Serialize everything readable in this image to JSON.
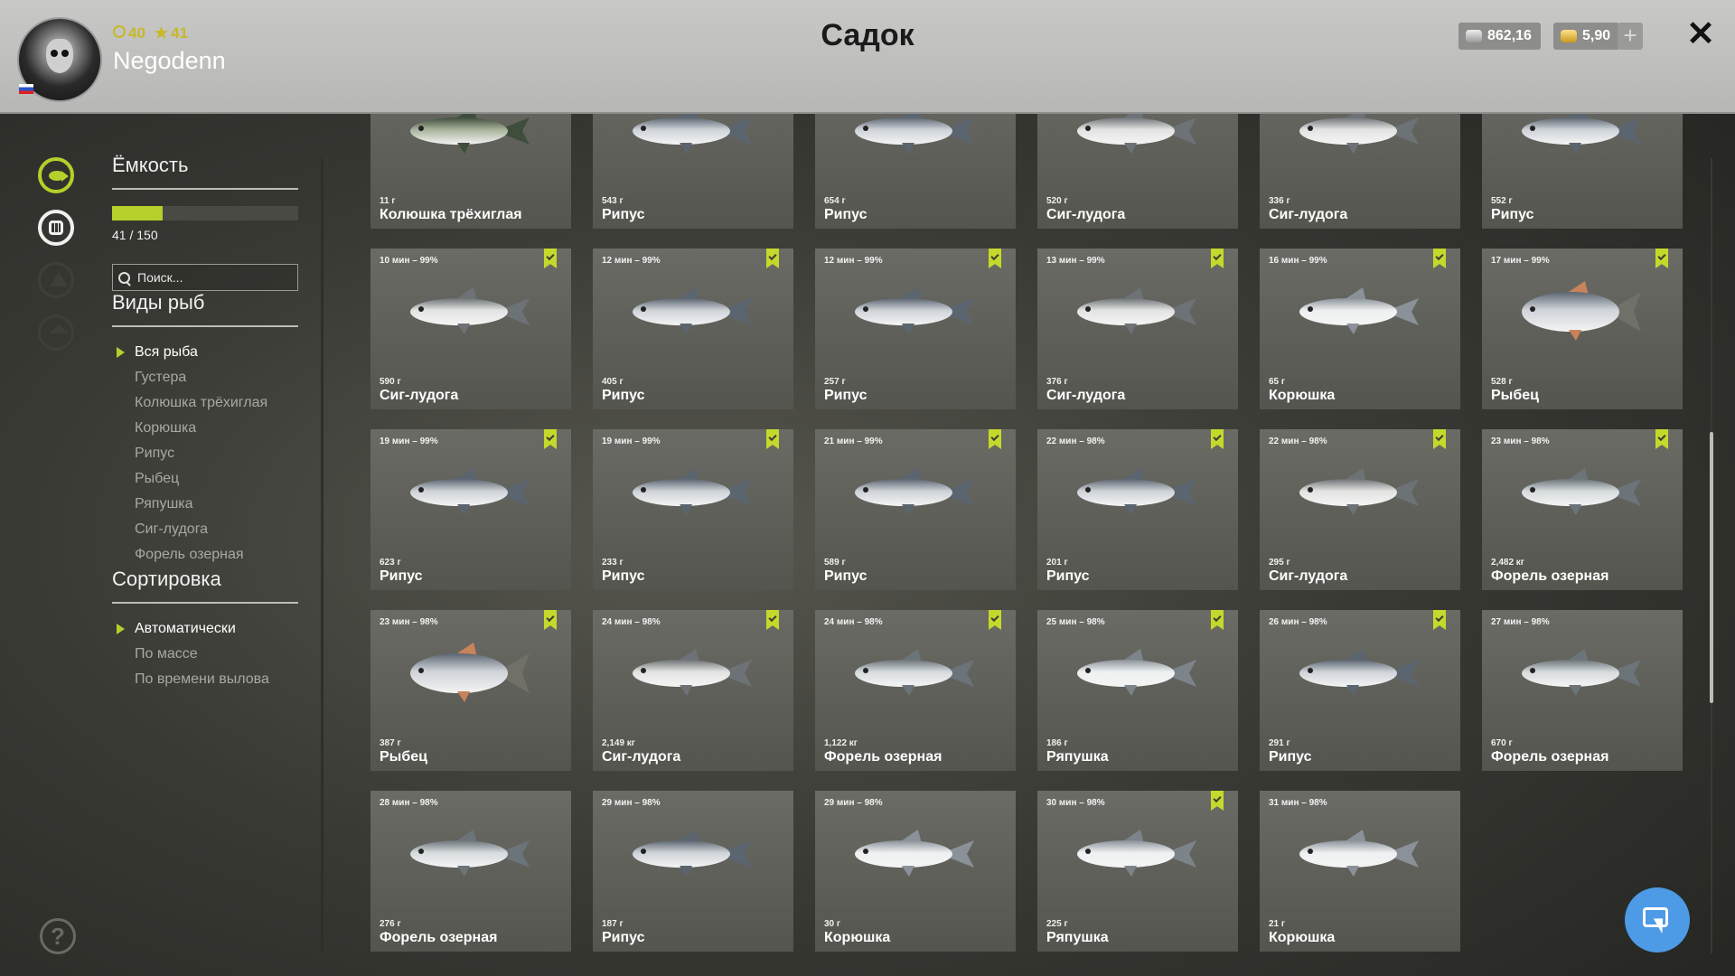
{
  "header": {
    "title": "Садок",
    "player": {
      "name": "Negodenn",
      "level": "40",
      "rank": "41"
    },
    "currency": {
      "silver": "862,16",
      "gold": "5,90"
    },
    "plus_label": "+",
    "close_label": "✕"
  },
  "sidebar": {
    "icons": [
      "fish-icon",
      "keepnet-icon",
      "boat-icon",
      "home-icon"
    ],
    "help_label": "?"
  },
  "capacity": {
    "title": "Ёмкость",
    "current": 41,
    "max": 150,
    "fill_fraction": 0.273,
    "text": "41 / 150"
  },
  "search": {
    "placeholder": "Поиск..."
  },
  "species_filter": {
    "title": "Виды рыб",
    "items": [
      "Вся рыба",
      "Густера",
      "Колюшка трёхиглая",
      "Корюшка",
      "Рипус",
      "Рыбец",
      "Ряпушка",
      "Сиг-лудога",
      "Форель озерная"
    ],
    "active_index": 0
  },
  "sort": {
    "title": "Сортировка",
    "items": [
      "Автоматически",
      "По массе",
      "По времени вылова"
    ],
    "active_index": 0
  },
  "colors": {
    "accent": "#b6cf2a",
    "button_blue": "#4d9be6",
    "card_bg": "#5f5f5a"
  },
  "scroll": {
    "position_fraction": 0.34
  },
  "fish": [
    {
      "time": "",
      "weight": "11 г",
      "species": "Колюшка трёхиглая",
      "bookmarked": false
    },
    {
      "time": "",
      "weight": "543 г",
      "species": "Рипус",
      "bookmarked": false
    },
    {
      "time": "",
      "weight": "654 г",
      "species": "Рипус",
      "bookmarked": false
    },
    {
      "time": "",
      "weight": "520 г",
      "species": "Сиг-лудога",
      "bookmarked": false
    },
    {
      "time": "",
      "weight": "336 г",
      "species": "Сиг-лудога",
      "bookmarked": false
    },
    {
      "time": "",
      "weight": "552 г",
      "species": "Рипус",
      "bookmarked": false
    },
    {
      "time": "10 мин – 99%",
      "weight": "590 г",
      "species": "Сиг-лудога",
      "bookmarked": true
    },
    {
      "time": "12 мин – 99%",
      "weight": "405 г",
      "species": "Рипус",
      "bookmarked": true
    },
    {
      "time": "12 мин – 99%",
      "weight": "257 г",
      "species": "Рипус",
      "bookmarked": true
    },
    {
      "time": "13 мин – 99%",
      "weight": "376 г",
      "species": "Сиг-лудога",
      "bookmarked": true
    },
    {
      "time": "16 мин – 99%",
      "weight": "65 г",
      "species": "Корюшка",
      "bookmarked": true
    },
    {
      "time": "17 мин – 99%",
      "weight": "528 г",
      "species": "Рыбец",
      "bookmarked": true
    },
    {
      "time": "19 мин – 99%",
      "weight": "623 г",
      "species": "Рипус",
      "bookmarked": true
    },
    {
      "time": "19 мин – 99%",
      "weight": "233 г",
      "species": "Рипус",
      "bookmarked": true
    },
    {
      "time": "21 мин – 99%",
      "weight": "589 г",
      "species": "Рипус",
      "bookmarked": true
    },
    {
      "time": "22 мин – 98%",
      "weight": "201 г",
      "species": "Рипус",
      "bookmarked": true
    },
    {
      "time": "22 мин – 98%",
      "weight": "295 г",
      "species": "Сиг-лудога",
      "bookmarked": true
    },
    {
      "time": "23 мин – 98%",
      "weight": "2,482 кг",
      "species": "Форель озерная",
      "bookmarked": true
    },
    {
      "time": "23 мин – 98%",
      "weight": "387 г",
      "species": "Рыбец",
      "bookmarked": true
    },
    {
      "time": "24 мин – 98%",
      "weight": "2,149 кг",
      "species": "Сиг-лудога",
      "bookmarked": true
    },
    {
      "time": "24 мин – 98%",
      "weight": "1,122 кг",
      "species": "Форель озерная",
      "bookmarked": true
    },
    {
      "time": "25 мин – 98%",
      "weight": "186 г",
      "species": "Ряпушка",
      "bookmarked": true
    },
    {
      "time": "26 мин – 98%",
      "weight": "291 г",
      "species": "Рипус",
      "bookmarked": true
    },
    {
      "time": "27 мин – 98%",
      "weight": "670 г",
      "species": "Форель озерная",
      "bookmarked": false
    },
    {
      "time": "28 мин – 98%",
      "weight": "276 г",
      "species": "Форель озерная",
      "bookmarked": false
    },
    {
      "time": "29 мин – 98%",
      "weight": "187 г",
      "species": "Рипус",
      "bookmarked": false
    },
    {
      "time": "29 мин – 98%",
      "weight": "30 г",
      "species": "Корюшка",
      "bookmarked": false
    },
    {
      "time": "30 мин – 98%",
      "weight": "225 г",
      "species": "Ряпушка",
      "bookmarked": true
    },
    {
      "time": "31 мин – 98%",
      "weight": "21 г",
      "species": "Корюшка",
      "bookmarked": false
    }
  ]
}
